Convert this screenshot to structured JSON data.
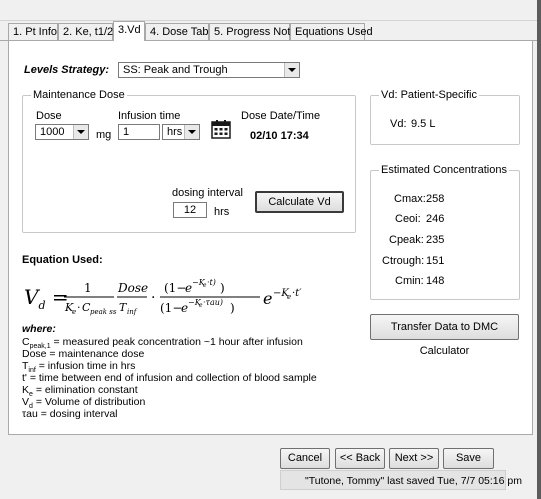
{
  "tabs": [
    {
      "label": "1. Pt Info"
    },
    {
      "label": "2. Ke, t1/2"
    },
    {
      "label": "3.Vd"
    },
    {
      "label": "4. Dose Table"
    },
    {
      "label": "5. Progress Note"
    },
    {
      "label": "Equations Used"
    }
  ],
  "active_tab": "3.Vd",
  "levels_strategy": {
    "label": "Levels Strategy:",
    "value": "SS: Peak and Trough"
  },
  "maintenance": {
    "group_title": "Maintenance Dose",
    "dose_label": "Dose",
    "dose_value": "1000",
    "dose_unit": "mg",
    "infusion_label": "Infusion time",
    "infusion_value": "1",
    "infusion_unit": "hrs",
    "datetime_label": "Dose Date/Time",
    "datetime_value": "02/10 17:34",
    "interval_label": "dosing interval",
    "interval_value": "12",
    "interval_unit": "hrs",
    "calculate_label": "Calculate Vd"
  },
  "vd_patient": {
    "group_title": "Vd: Patient-Specific",
    "label": "Vd:",
    "value": "9.5 L"
  },
  "concentrations": {
    "group_title": "Estimated Concentrations",
    "rows": [
      {
        "label": "Cmax:",
        "value": "258"
      },
      {
        "label": "Ceoi:",
        "value": "246"
      },
      {
        "label": "Cpeak:",
        "value": "235"
      },
      {
        "label": "Ctrough:",
        "value": "151"
      },
      {
        "label": "Cmin:",
        "value": "148"
      }
    ]
  },
  "transfer_label": "Transfer Data to DMC Calculator",
  "equation": {
    "heading": "Equation Used:",
    "lhs": "V",
    "lhs_sub": "d",
    "where": "where:",
    "legend": [
      {
        "sym": "C",
        "sub": "peak,1",
        "text": " = measured peak concentration ~1 hour after infusion"
      },
      {
        "sym": "Dose",
        "sub": "",
        "text": " = maintenance dose"
      },
      {
        "sym": "T",
        "sub": "inf",
        "text": " = infusion time in hrs"
      },
      {
        "sym": "t'",
        "sub": "",
        "text": " = time between end of infusion and collection of blood sample"
      },
      {
        "sym": "K",
        "sub": "e",
        "text": " = elimination constant"
      },
      {
        "sym": "V",
        "sub": "d",
        "text": " = Volume of distribution"
      },
      {
        "sym": "τau",
        "sub": "",
        "text": " = dosing interval"
      }
    ]
  },
  "nav": {
    "cancel": "Cancel",
    "back": "<< Back",
    "next": "Next >>",
    "save": "Save"
  },
  "status": "\"Tutone, Tommy\" last saved Tue, 7/7 05:16 pm"
}
